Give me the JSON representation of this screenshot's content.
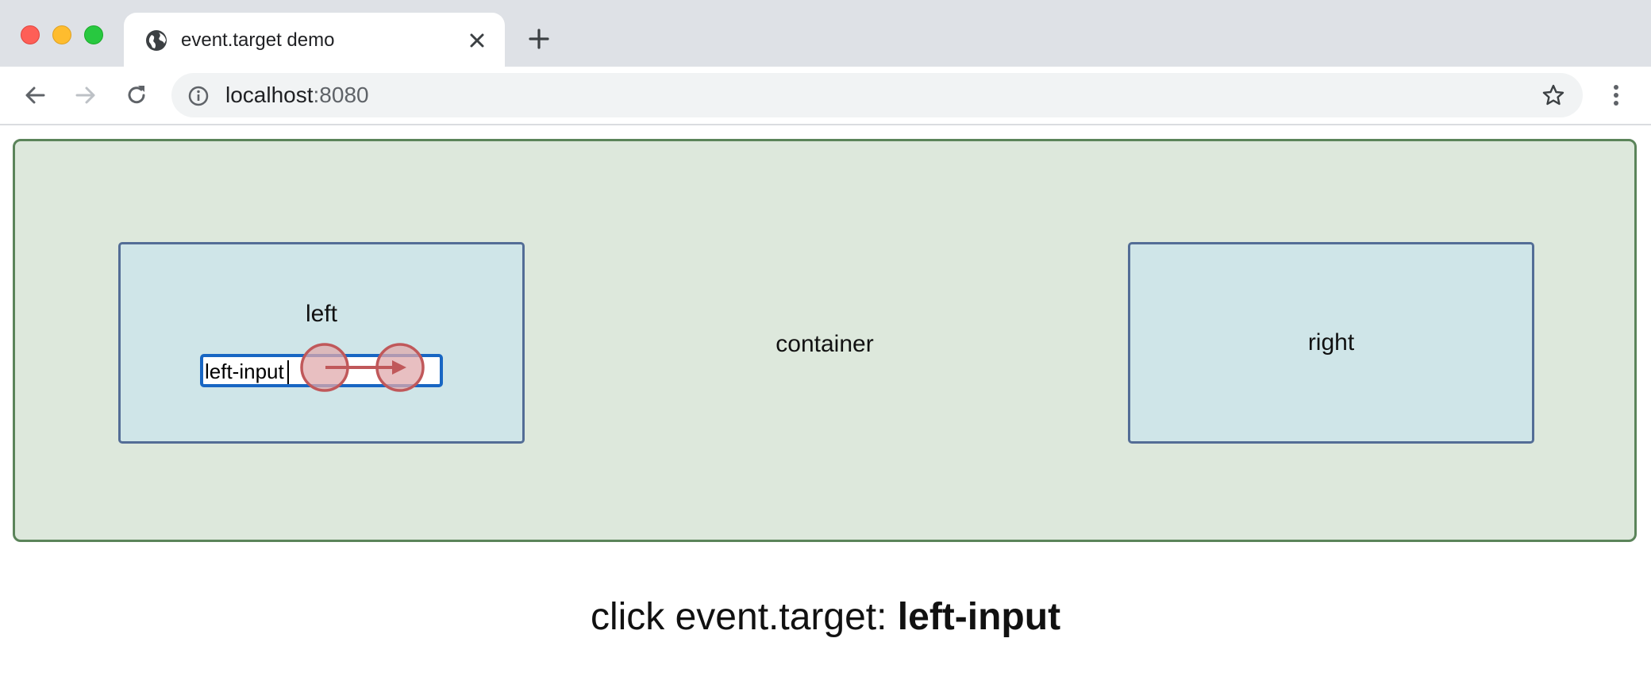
{
  "browser": {
    "tab": {
      "title": "event.target demo"
    },
    "address": {
      "host": "localhost",
      "port": ":8080"
    }
  },
  "page": {
    "container": {
      "label": "container"
    },
    "left": {
      "label": "left",
      "input_value": "left-input"
    },
    "right": {
      "label": "right"
    },
    "status": {
      "prefix": "click event.target: ",
      "target": "left-input"
    }
  },
  "icons": {
    "favicon": "globe-icon",
    "close": "close-icon",
    "new_tab": "plus-icon",
    "back": "back-arrow-icon",
    "forward": "forward-arrow-icon",
    "reload": "reload-icon",
    "info": "info-icon",
    "bookmark": "star-icon",
    "menu": "kebab-menu-icon",
    "drag": "drag-gesture-indicator"
  },
  "colors": {
    "container_bg": "#dde8dc",
    "container_border": "#5b845a",
    "box_bg": "#cfe5e8",
    "box_border": "#536d96",
    "input_focus": "#1866c3",
    "drag_marker": "#c0585a"
  }
}
